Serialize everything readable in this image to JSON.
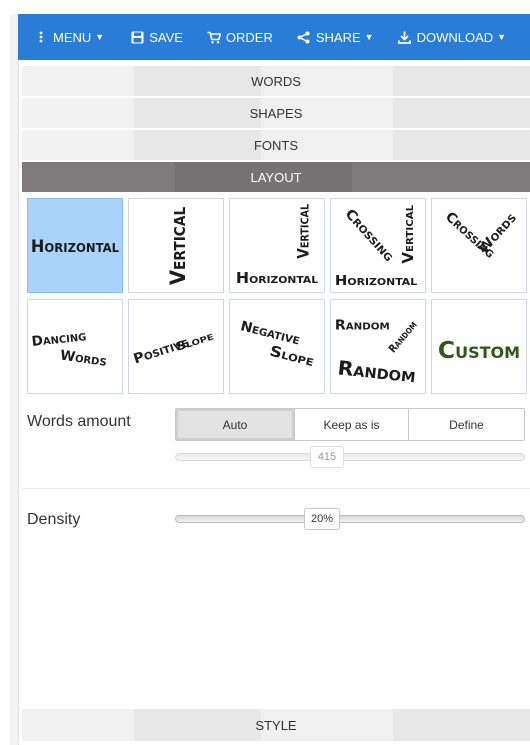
{
  "toolbar": {
    "menu": "MENU",
    "save": "SAVE",
    "order": "ORDER",
    "share": "SHARE",
    "download": "DOWNLOAD"
  },
  "accordion": {
    "words": "WORDS",
    "shapes": "SHAPES",
    "fonts": "FONTS",
    "layout": "LAYOUT",
    "style": "STYLE"
  },
  "layouts": [
    {
      "id": "horizontal",
      "words": [
        "Horizontal"
      ],
      "selected": true
    },
    {
      "id": "vertical",
      "words": [
        "Vertical"
      ]
    },
    {
      "id": "vertical-horizontal",
      "words": [
        "Vertical",
        "Horizontal"
      ]
    },
    {
      "id": "crossing-vertical-horizontal",
      "words": [
        "Crossing",
        "Vertical",
        "Horizontal"
      ]
    },
    {
      "id": "crossing-words",
      "words": [
        "Crossing",
        "Words"
      ]
    },
    {
      "id": "dancing-words",
      "words": [
        "Dancing",
        "Words"
      ]
    },
    {
      "id": "positive-slope",
      "words": [
        "Positive",
        "Slope"
      ]
    },
    {
      "id": "negative-slope",
      "words": [
        "Negative",
        "Slope"
      ]
    },
    {
      "id": "random",
      "words": [
        "Random",
        "Random",
        "Random"
      ]
    },
    {
      "id": "custom",
      "words": [
        "Custom"
      ]
    }
  ],
  "words_amount": {
    "label": "Words amount",
    "options": [
      "Auto",
      "Keep as is",
      "Define"
    ],
    "selected": "Auto",
    "slider_value": "415",
    "slider_fraction": 0.39
  },
  "density": {
    "label": "Density",
    "value": "20%",
    "slider_fraction": 0.42
  },
  "colors": {
    "toolbar": "#2a7dd6",
    "active_section": "#7a7678",
    "selected_tile": "#a9d3f9",
    "custom_text": "#2d5a17"
  }
}
